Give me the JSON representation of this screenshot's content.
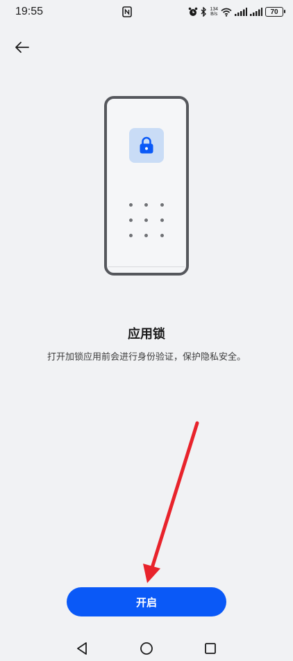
{
  "status_bar": {
    "time": "19:55",
    "net_speed_value": "134",
    "net_speed_unit": "B/s",
    "battery_level": "70",
    "icons": [
      "nfc-icon",
      "alarm-icon",
      "bluetooth-icon",
      "wifi-icon",
      "signal-icon",
      "signal-icon-2",
      "battery-icon"
    ]
  },
  "header": {
    "back_icon": "back-arrow-icon"
  },
  "illustration": {
    "icon": "lock-icon"
  },
  "main": {
    "title": "应用锁",
    "description": "打开加锁应用前会进行身份验证，保护隐私安全。"
  },
  "actions": {
    "enable_label": "开启"
  },
  "nav_bar": {
    "icons": [
      "back-triangle-icon",
      "home-circle-icon",
      "recents-square-icon"
    ]
  },
  "colors": {
    "background": "#f1f2f4",
    "accent": "#0a59f7",
    "lock_tile": "#c9dcf6",
    "annotation_arrow": "#e8232b"
  }
}
